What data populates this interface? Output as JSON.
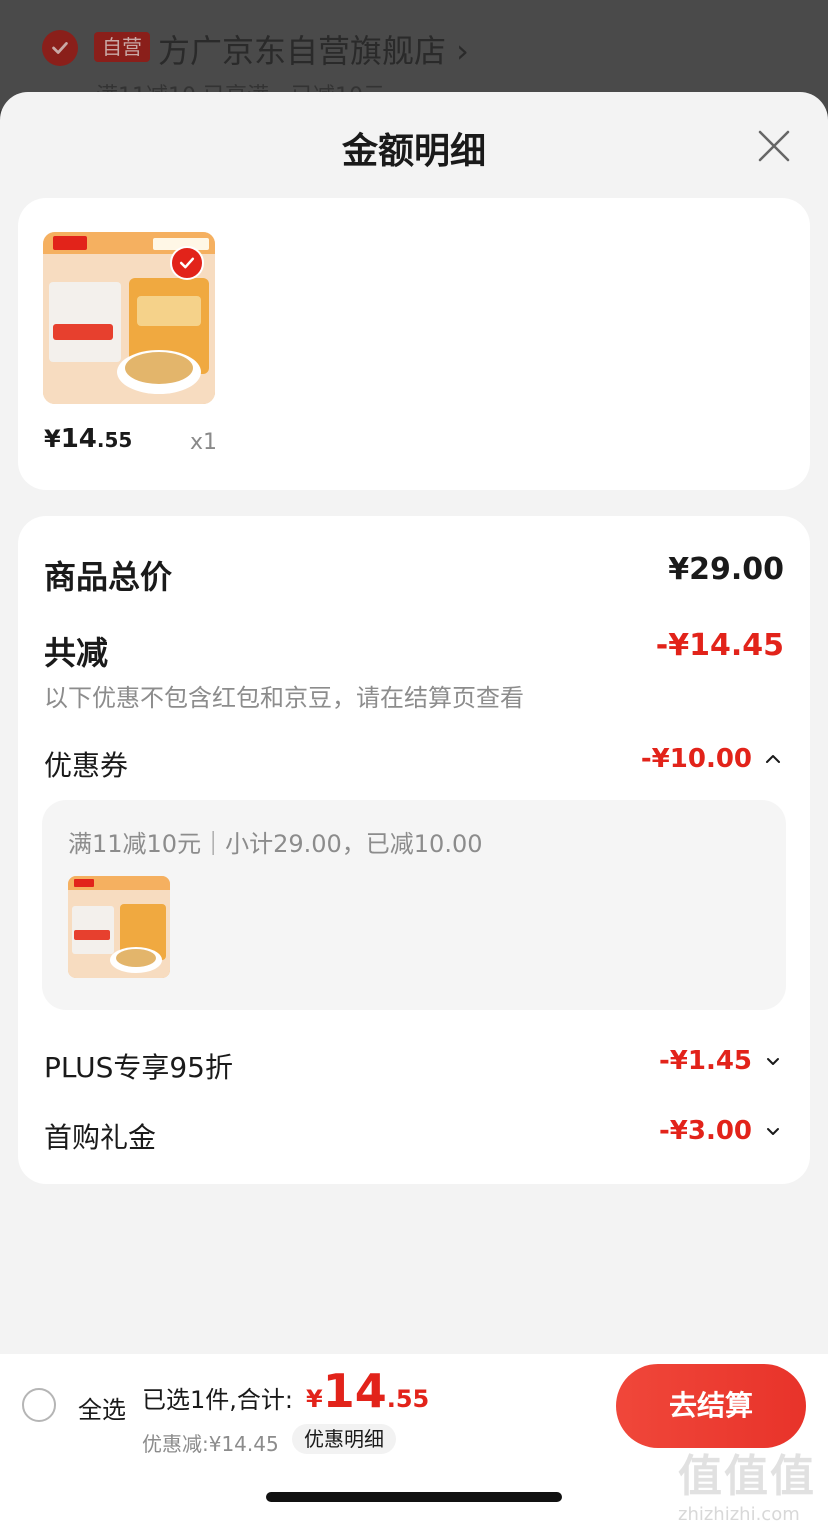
{
  "background": {
    "store_tag": "自营",
    "store_name": "方广京东自营旗舰店 ›",
    "store_sub": "满11减10  已享满，已减10元"
  },
  "sheet": {
    "title": "金额明细"
  },
  "product": {
    "price_yen": "¥",
    "price_int": "14",
    "price_dec": ".55",
    "quantity": "x1"
  },
  "detail": {
    "total_label": "商品总价",
    "total_value": "¥29.00",
    "reduce_label": "共减",
    "reduce_value": "-¥14.45",
    "reduce_note": "以下优惠不包含红包和京豆，请在结算页查看",
    "coupon_label": "优惠券",
    "coupon_value": "-¥10.00",
    "coupon_detail_text": "满11减10元｜小计29.00，已减10.00",
    "plus_label": "PLUS专享95折",
    "plus_value": "-¥1.45",
    "firstbuy_label": "首购礼金",
    "firstbuy_value": "-¥3.00"
  },
  "bottom_bar": {
    "select_all": "全选",
    "summary": "已选1件,合计:",
    "total_yen": "¥",
    "total_int": "14",
    "total_dec": ".55",
    "discount_text": "优惠减:¥14.45",
    "detail_pill": "优惠明细",
    "checkout": "去结算"
  },
  "watermark": {
    "chars": "值值值",
    "url": "zhizhizhi.com"
  },
  "colors": {
    "accent_red": "#e2231a",
    "checkout_gradient_start": "#f0473a",
    "checkout_gradient_end": "#e8332a"
  }
}
